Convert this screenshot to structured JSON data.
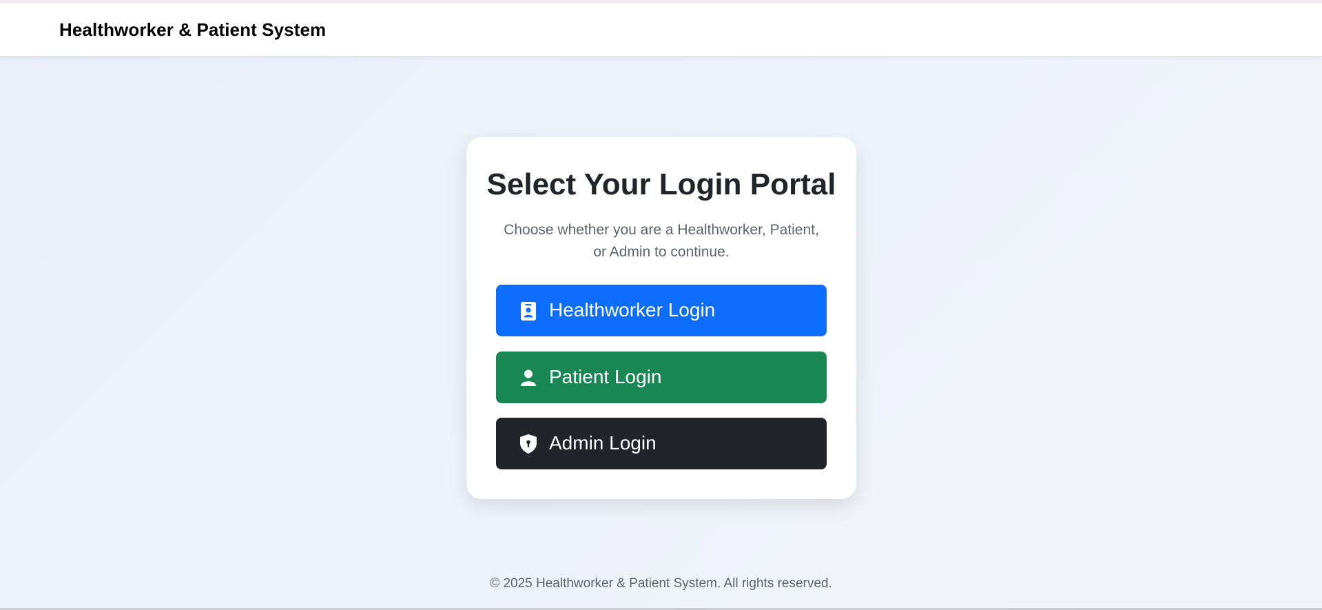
{
  "navbar": {
    "brand": "Healthworker & Patient System"
  },
  "card": {
    "title": "Select Your Login Portal",
    "subtitle": "Choose whether you are a Healthworker, Patient, or Admin to continue.",
    "buttons": [
      {
        "label": "Healthworker Login",
        "icon": "id-badge-icon",
        "color": "#0d6efd"
      },
      {
        "label": "Patient Login",
        "icon": "person-icon",
        "color": "#198754"
      },
      {
        "label": "Admin Login",
        "icon": "shield-lock-icon",
        "color": "#212529"
      }
    ]
  },
  "footer": {
    "text": "© 2025 Healthworker & Patient System. All rights reserved."
  },
  "colors": {
    "primary": "#0d6efd",
    "success": "#198754",
    "dark": "#212529",
    "muted_text": "#5c636a"
  }
}
